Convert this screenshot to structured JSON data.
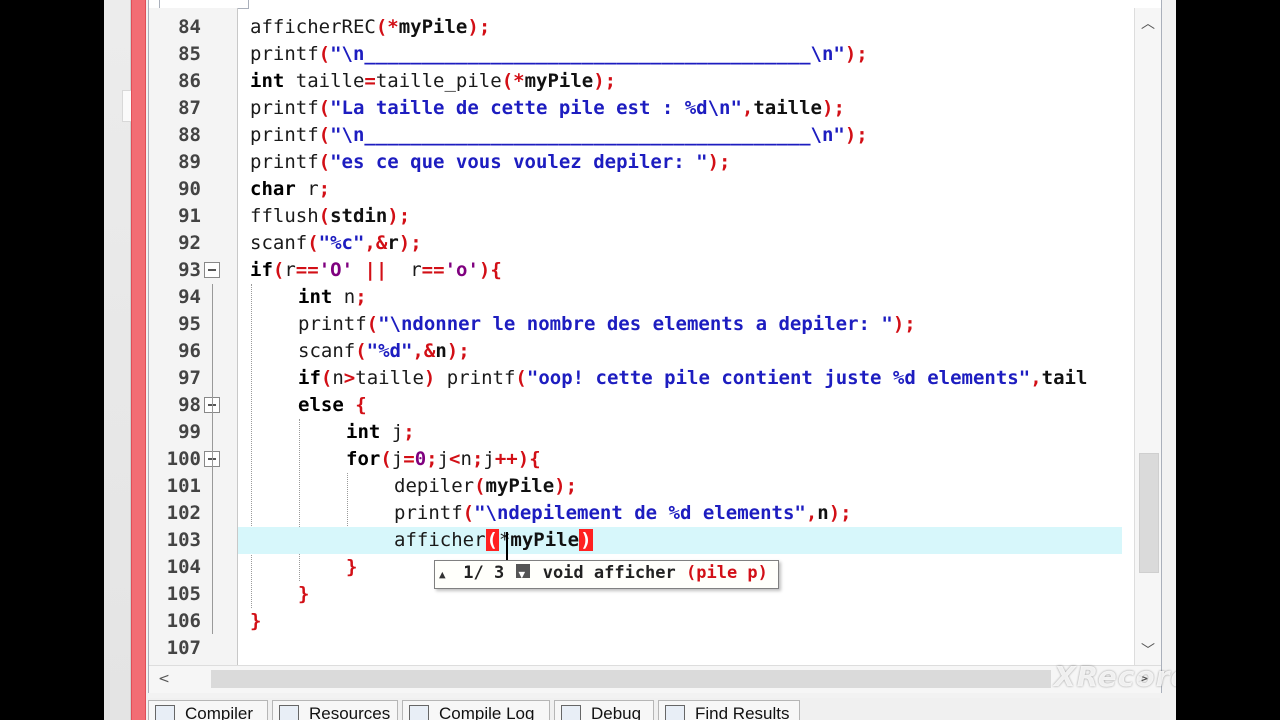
{
  "editor": {
    "lines": [
      {
        "num": "84"
      },
      {
        "num": "85"
      },
      {
        "num": "86"
      },
      {
        "num": "87"
      },
      {
        "num": "88"
      },
      {
        "num": "89"
      },
      {
        "num": "90"
      },
      {
        "num": "91"
      },
      {
        "num": "92"
      },
      {
        "num": "93"
      },
      {
        "num": "94"
      },
      {
        "num": "95"
      },
      {
        "num": "96"
      },
      {
        "num": "97"
      },
      {
        "num": "98"
      },
      {
        "num": "99"
      },
      {
        "num": "100"
      },
      {
        "num": "101"
      },
      {
        "num": "102"
      },
      {
        "num": "103"
      },
      {
        "num": "104"
      },
      {
        "num": "105"
      },
      {
        "num": "106"
      },
      {
        "num": "107"
      }
    ],
    "code": {
      "l84_fn": "afficherREC",
      "l84_arg": "myPile",
      "l85_fn": "printf",
      "l85_str": "\"\\n_______________________________________\\n\"",
      "l86_kw": "int",
      "l86_var": " taille",
      "l86_fn": "taille_pile",
      "l86_arg": "myPile",
      "l87_fn": "printf",
      "l87_str": "\"La taille de cette pile est : %d\\n\"",
      "l87_arg": "taille",
      "l88_fn": "printf",
      "l88_str": "\"\\n_______________________________________\\n\"",
      "l89_fn": "printf",
      "l89_str": "\"es ce que vous voulez depiler: \"",
      "l90_kw": "char",
      "l90_var": " r",
      "l91_fn": "fflush",
      "l91_arg": "stdin",
      "l92_fn": "scanf",
      "l92_str": "\"%c\"",
      "l92_arg": "r",
      "l93_kw": "if",
      "l93_a": "r",
      "l93_c1": "'O'",
      "l93_b": " r",
      "l93_c2": "'o'",
      "l94_kw": "int",
      "l94_var": " n",
      "l95_fn": "printf",
      "l95_str": "\"\\ndonner le nombre des elements a depiler: \"",
      "l96_fn": "scanf",
      "l96_str": "\"%d\"",
      "l96_arg": "n",
      "l97_kw": "if",
      "l97_a": "n",
      "l97_b": "taille",
      "l97_fn": " printf",
      "l97_str": "\"oop! cette pile contient juste %d elements\"",
      "l97_tail": "tail",
      "l98_kw": "else",
      "l99_kw": "int",
      "l99_var": " j",
      "l100_kw": "for",
      "l100_a": "j",
      "l100_zero": "0",
      "l100_b": "j",
      "l100_c": "n",
      "l100_d": "j",
      "l101_fn": "depiler",
      "l101_arg": "myPile",
      "l102_fn": "printf",
      "l102_str": "\"\\ndepilement de %d elements\"",
      "l102_arg": "n",
      "l103_fn": "afficher",
      "l103_arg": "myPile"
    },
    "tooltip": {
      "counter": "1/ 3",
      "signature_prefix": "void afficher ",
      "signature_param": "(pile p)"
    }
  },
  "bottom_tabs": [
    {
      "label": "Compiler"
    },
    {
      "label": "Resources"
    },
    {
      "label": "Compile Log"
    },
    {
      "label": "Debug"
    },
    {
      "label": "Find Results"
    }
  ],
  "watermark": "XRecorder"
}
